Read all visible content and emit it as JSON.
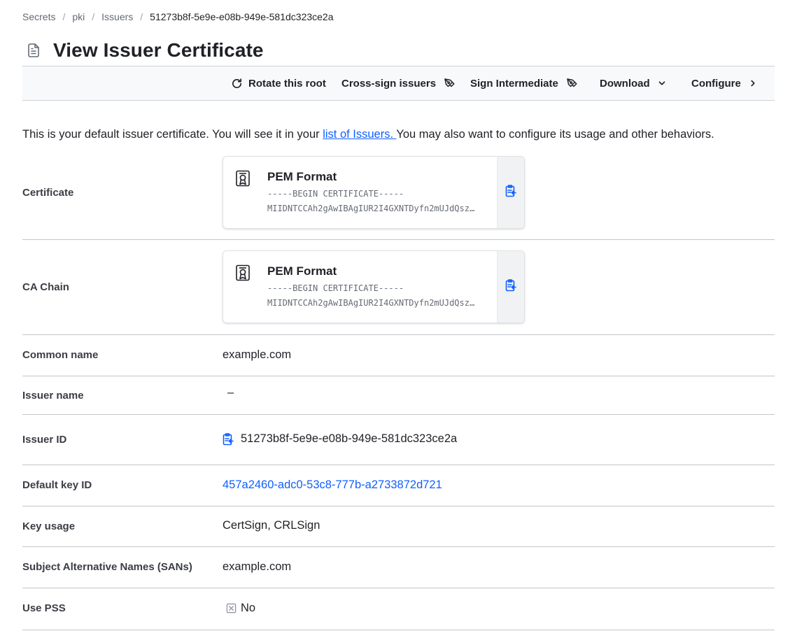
{
  "breadcrumb": {
    "items": [
      "Secrets",
      "pki",
      "Issuers"
    ],
    "current": "51273b8f-5e9e-e08b-949e-581dc323ce2a",
    "separator": "/"
  },
  "page": {
    "title": "View Issuer Certificate",
    "title_icon": "file-text-icon"
  },
  "toolbar": {
    "rotate": {
      "label": "Rotate this root",
      "icon": "rotate-icon"
    },
    "cross_sign": {
      "label": "Cross-sign issuers",
      "icon": "pen-tool-icon"
    },
    "sign_intermediate": {
      "label": "Sign Intermediate",
      "icon": "pen-tool-icon"
    },
    "download": {
      "label": "Download",
      "icon": "chevron-down-icon"
    },
    "configure": {
      "label": "Configure",
      "icon": "chevron-right-icon"
    }
  },
  "description": {
    "before": "This is your default issuer certificate. You will see it in your ",
    "link": "list of Issuers. ",
    "after": "You may also want to configure its usage and other behaviors."
  },
  "details": {
    "certificate": {
      "label": "Certificate",
      "format": "PEM Format",
      "line1": "-----BEGIN CERTIFICATE-----",
      "line2": "MIIDNTCCAh2gAwIBAgIUR2I4GXNTDyfn2mUJdQsz…"
    },
    "ca_chain": {
      "label": "CA Chain",
      "format": "PEM Format",
      "line1": "-----BEGIN CERTIFICATE-----",
      "line2": "MIIDNTCCAh2gAwIBAgIUR2I4GXNTDyfn2mUJdQsz…"
    },
    "common_name": {
      "label": "Common name",
      "value": "example.com"
    },
    "issuer_name": {
      "label": "Issuer name",
      "value": "–"
    },
    "issuer_id": {
      "label": "Issuer ID",
      "value": "51273b8f-5e9e-e08b-949e-581dc323ce2a"
    },
    "default_key_id": {
      "label": "Default key ID",
      "value": "457a2460-adc0-53c8-777b-a2733872d721"
    },
    "key_usage": {
      "label": "Key usage",
      "value": "CertSign, CRLSign"
    },
    "sans": {
      "label": "Subject Alternative Names (SANs)",
      "value": "example.com"
    },
    "use_pss": {
      "label": "Use PSS",
      "value": "No",
      "icon": "x-square-icon"
    }
  },
  "colors": {
    "link": "#1060ff",
    "text": "#1f2126",
    "muted": "#656a76",
    "border": "#c2c5cb",
    "toolbar_bg": "#f8f9fa"
  }
}
